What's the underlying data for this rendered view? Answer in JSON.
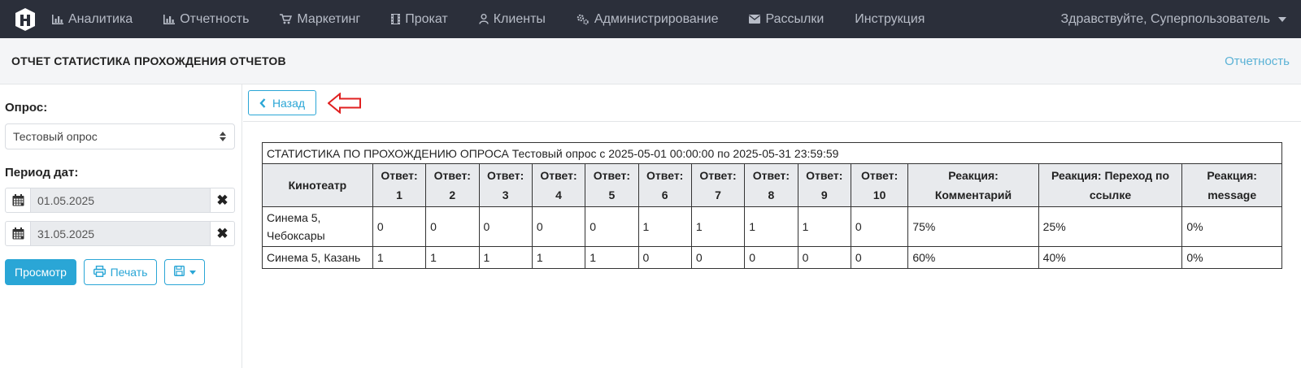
{
  "navbar": {
    "items": [
      {
        "label": "Аналитика",
        "icon": "bar-chart-icon"
      },
      {
        "label": "Отчетность",
        "icon": "bar-chart-icon"
      },
      {
        "label": "Маркетинг",
        "icon": "cart-icon"
      },
      {
        "label": "Прокат",
        "icon": "film-icon"
      },
      {
        "label": "Клиенты",
        "icon": "user-icon"
      },
      {
        "label": "Администрирование",
        "icon": "cogs-icon"
      },
      {
        "label": "Рассылки",
        "icon": "envelope-icon"
      },
      {
        "label": "Инструкция",
        "icon": ""
      }
    ],
    "user_greeting": "Здравствуйте, Суперпользователь"
  },
  "header": {
    "title": "ОТЧЕТ СТАТИСТИКА ПРОХОЖДЕНИЯ ОТЧЕТОВ",
    "breadcrumb": "Отчетность"
  },
  "sidebar": {
    "survey_label": "Опрос:",
    "survey_value": "Тестовый опрос",
    "period_label": "Период дат:",
    "date_from": "01.05.2025",
    "date_to": "31.05.2025",
    "view_button": "Просмотр",
    "print_button": "Печать"
  },
  "main": {
    "back_button": "Назад",
    "annotation_color": "#e02020"
  },
  "report": {
    "caption": "СТАТИСТИКА ПО ПРОХОЖДЕНИЮ ОПРОСА Тестовый опрос с 2025-05-01 00:00:00 по 2025-05-31 23:59:59",
    "columns": [
      "Кинотеатр",
      "Ответ: 1",
      "Ответ: 2",
      "Ответ: 3",
      "Ответ: 4",
      "Ответ: 5",
      "Ответ: 6",
      "Ответ: 7",
      "Ответ: 8",
      "Ответ: 9",
      "Ответ: 10",
      "Реакция: Комментарий",
      "Реакция: Переход по ссылке",
      "Реакция: message"
    ],
    "rows": [
      [
        "Синема 5, Чебоксары",
        "0",
        "0",
        "0",
        "0",
        "0",
        "1",
        "1",
        "1",
        "1",
        "0",
        "75%",
        "25%",
        "0%"
      ],
      [
        "Синема 5, Казань",
        "1",
        "1",
        "1",
        "1",
        "1",
        "0",
        "0",
        "0",
        "0",
        "0",
        "60%",
        "40%",
        "0%"
      ]
    ]
  },
  "colors": {
    "navbar_bg": "#2b2f3a",
    "accent": "#2aa6d6"
  }
}
